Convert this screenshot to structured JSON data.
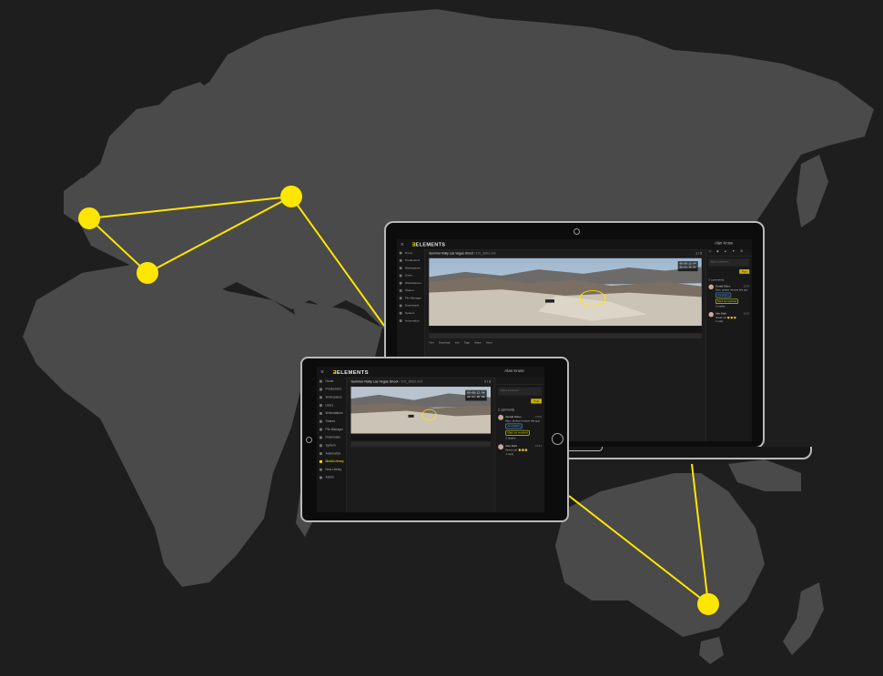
{
  "colors": {
    "accent": "#ffe600",
    "land": "#4a4a4a",
    "ocean": "#1e1e1e",
    "screen_bg": "#1c1c1d"
  },
  "map": {
    "locations": [
      {
        "name": "london-pin"
      },
      {
        "name": "rome-pin"
      },
      {
        "name": "moscow-pin"
      },
      {
        "name": "sydney-pin"
      }
    ]
  },
  "laptop_app": {
    "logo": "ELEMENTS",
    "user_name": "Alan Kruse",
    "sidebar": [
      {
        "label": "Home"
      },
      {
        "label": "Productions"
      },
      {
        "label": "Workspaces"
      },
      {
        "label": "Users"
      },
      {
        "label": "Workstations"
      },
      {
        "label": "Shares"
      },
      {
        "label": "File Manager"
      },
      {
        "label": "Downloads"
      },
      {
        "label": "System"
      },
      {
        "label": "Automation"
      }
    ],
    "asset_title": "Summer Rally Las Vegas Shoot",
    "asset_sub": "/ 101_8663.mxf",
    "counter": "1 / 3",
    "timecode_1": "00:00:12:04",
    "timecode_2": "00:01:36:08",
    "toolbar": [
      "Trim",
      "Download",
      "Info",
      "Tags",
      "Share",
      "Move"
    ],
    "panel_tabs": [
      "◎",
      "◆",
      "▲",
      "▼",
      "⚙"
    ],
    "comment_placeholder": "Add a comment...",
    "post_label": "Post",
    "comments_head": "2 comments",
    "comments": [
      {
        "name": "Gerald Olsen",
        "text": "Nice, please remove this guy",
        "time": "12:04",
        "tag": "Annotation",
        "tag2": "Mark as resolved",
        "foot": "2 replies"
      },
      {
        "name": "Alex Dahl",
        "text": "Great cut! 👏👏👏",
        "time": "13:22",
        "foot": "1 reply"
      }
    ]
  },
  "tablet_app": {
    "logo": "ELEMENTS",
    "user_name": "Alan Kruse",
    "sidebar": [
      {
        "label": "Home"
      },
      {
        "label": "Productions"
      },
      {
        "label": "Workspaces"
      },
      {
        "label": "Users"
      },
      {
        "label": "Workstations"
      },
      {
        "label": "Shares"
      },
      {
        "label": "File Manager"
      },
      {
        "label": "Downloads"
      },
      {
        "label": "System"
      },
      {
        "label": "Automation"
      },
      {
        "label": "Media Library"
      },
      {
        "label": "New Library"
      },
      {
        "label": "Admin"
      }
    ],
    "asset_title": "Summer Rally Las Vegas Shoot",
    "asset_sub": "/ 101_8663.mxf",
    "counter": "1 / 3",
    "timecode_1": "00:00:12:04",
    "timecode_2": "00:01:36:08",
    "comment_placeholder": "Add a comment...",
    "post_label": "Post",
    "comments_head": "2 comments",
    "comments": [
      {
        "name": "Gerald Olsen",
        "text": "Nice, please remove this guy",
        "time": "12:04",
        "tag": "Annotation",
        "tag2": "Mark as resolved",
        "foot": "2 replies"
      },
      {
        "name": "Alex Dahl",
        "text": "Great cut! 👏👏👏",
        "time": "13:22",
        "foot": "1 reply"
      }
    ]
  }
}
